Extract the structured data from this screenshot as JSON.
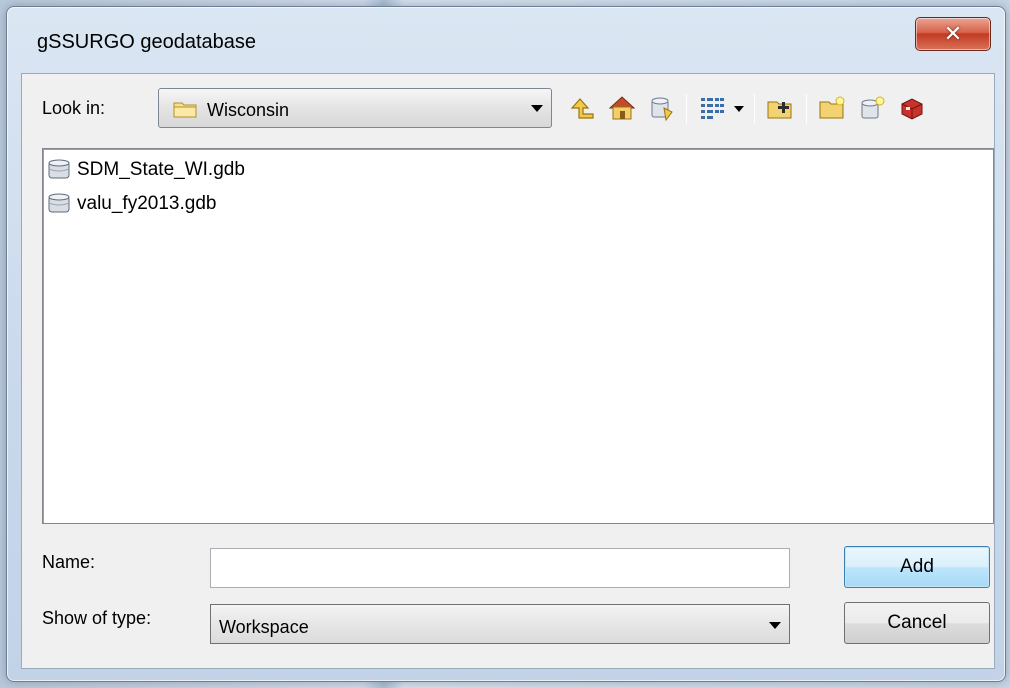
{
  "window": {
    "title": "gSSURGO geodatabase",
    "close_glyph": "✕"
  },
  "lookin": {
    "label": "Look in:",
    "value": "Wisconsin",
    "icon": "folder-icon"
  },
  "toolbar": {
    "buttons": [
      {
        "name": "up-one-level-icon"
      },
      {
        "name": "home-icon"
      },
      {
        "name": "connect-database-icon"
      },
      {
        "name": "view-list-icon"
      },
      {
        "name": "connect-folder-icon"
      },
      {
        "name": "new-folder-icon"
      },
      {
        "name": "new-geodatabase-icon"
      },
      {
        "name": "toolbox-icon"
      }
    ]
  },
  "files": [
    {
      "label": "SDM_State_WI.gdb",
      "icon": "file-geodatabase-icon"
    },
    {
      "label": "valu_fy2013.gdb",
      "icon": "file-geodatabase-icon"
    }
  ],
  "name_field": {
    "label": "Name:",
    "value": "",
    "placeholder": ""
  },
  "type_field": {
    "label": "Show of type:",
    "value": "Workspace"
  },
  "actions": {
    "add_label": "Add",
    "cancel_label": "Cancel"
  },
  "colors": {
    "close_button": "#c23b22",
    "default_button_border": "#3c7fb1"
  }
}
